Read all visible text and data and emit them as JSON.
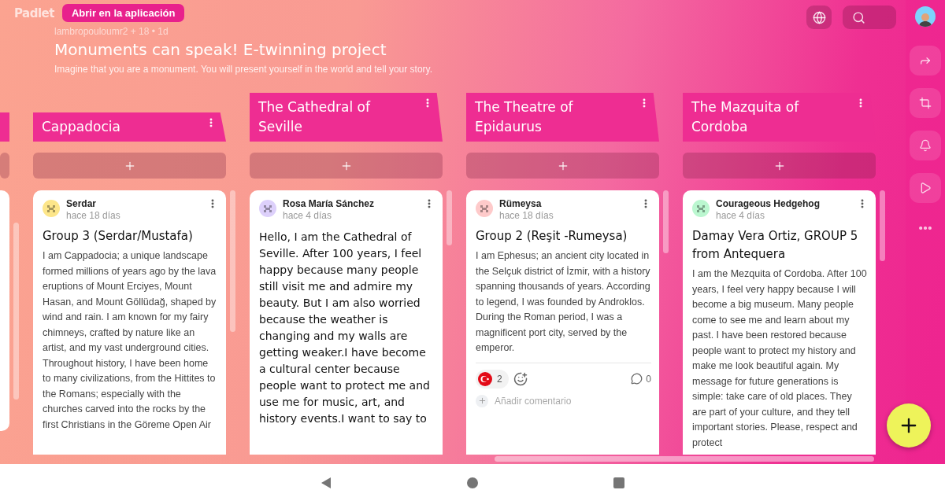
{
  "app": {
    "logo": "Padlet",
    "open_app_button": "Abrir en la aplicación"
  },
  "board": {
    "meta": "lambropouloumr2 + 18 • 1d",
    "title": "Monuments can speak! E-twinning project",
    "description": "Imagine that you are a monument. You will present yourself in the world and tell your story."
  },
  "columns": [
    {
      "title": "Cappadocia",
      "posts": [
        {
          "author": "Serdar",
          "time": "hace 18 días",
          "color": "#fde68a",
          "title": "Group 3 (Serdar/Mustafa)",
          "body": "I am Cappadocia; a unique landscape formed millions of years ago by the lava eruptions of Mount Erciyes, Mount Hasan, and Mount Göllüdağ, shaped by wind and rain. I am known for my fairy chimneys, crafted by nature like an artist, and my vast underground cities. Throughout history, I have been home to many civilizations, from the Hittites to the Romans; especially with the churches carved into the rocks by the first Christians in the Göreme Open Air"
        }
      ]
    },
    {
      "title": "The Cathedral of Seville",
      "posts": [
        {
          "author": "Rosa María Sánchez",
          "time": "hace 4 días",
          "color": "#ddd0fb",
          "body": "Hello, I am the Cathedral of Seville. After 100 years, I feel happy because many people still visit me and admire my beauty. But I am also worried because the weather is changing and my walls are getting weaker.I have become a cultural center because people want to protect me and use me for music, art, and history events.I want to say to"
        }
      ]
    },
    {
      "title": "The Theatre of Epidaurus",
      "posts": [
        {
          "author": "Rümeysa",
          "time": "hace 18 días",
          "color": "#fecaca",
          "title": "Group 2 (Reşit -Rumeysa)",
          "body": "I am Ephesus; an ancient city located in the Selçuk district of İzmir, with a history spanning thousands of years. According to legend, I was founded by Androklos. During the Roman period, I was a magnificent port city, served by the emperor.",
          "reactions": [
            {
              "count": "2"
            }
          ],
          "comment_count": "0",
          "comment_prompt": "Añadir comentario"
        }
      ]
    },
    {
      "title": "The Mazquita of Cordoba",
      "posts": [
        {
          "author": "Courageous Hedgehog",
          "time": "hace 4 días",
          "color": "#bbf7d0",
          "title": "Damay Vera Ortiz, GROUP 5 from Antequera",
          "body": "I am the Mezquita of Cordoba. After 100 years, I feel very happy because I will become a big museum. Many people come to see me and learn about my past. I have been restored because people want to protect my history and make me look beautiful again. My message for future generations is simple: take care of old places. They are part of your culture, and they tell important stories. Please, respect and protect"
        }
      ]
    }
  ]
}
